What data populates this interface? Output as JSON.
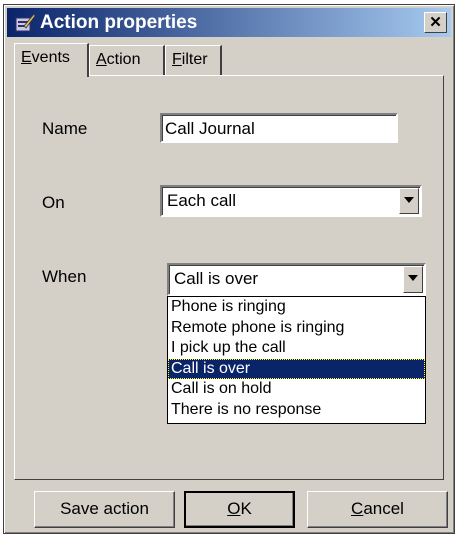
{
  "window": {
    "title": "Action properties",
    "close_glyph": "✕",
    "icon": "app-icon"
  },
  "tabs": [
    {
      "label": "Events",
      "mnemonic": "E",
      "rest": "vents",
      "active": true
    },
    {
      "label": "Action",
      "mnemonic": "A",
      "rest": "ction",
      "active": false
    },
    {
      "label": "Filter",
      "mnemonic": "F",
      "rest": "ilter",
      "active": false
    }
  ],
  "form": {
    "name_label": "Name",
    "name_value": "Call Journal",
    "on_label": "On",
    "on_value": "Each call",
    "when_label": "When",
    "when_value": "Call is over"
  },
  "when_options": [
    "Phone is ringing",
    "Remote phone is ringing",
    "I pick up the call",
    "Call is over",
    "Call is on hold",
    "There is no response"
  ],
  "when_selected_index": 3,
  "buttons": {
    "save": "Save action",
    "ok_mnemonic": "O",
    "ok_rest": "K",
    "cancel_mnemonic": "C",
    "cancel_rest": "ancel"
  },
  "colors": {
    "titlebar_start": "#0a246a",
    "titlebar_end": "#a6caf0",
    "face": "#d4d0c8",
    "selection": "#0a246a"
  }
}
